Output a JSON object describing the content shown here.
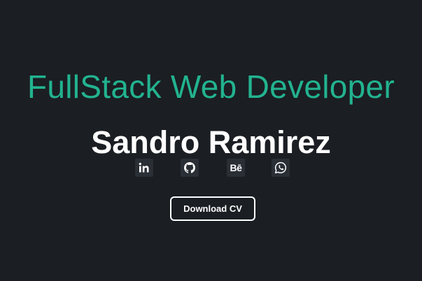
{
  "hero": {
    "role": "FullStack Web Developer",
    "name": "Sandro Ramirez",
    "download_label": "Download CV"
  },
  "socials": [
    {
      "name": "linkedin",
      "icon": "linkedin-icon",
      "text": "in"
    },
    {
      "name": "github",
      "icon": "github-icon"
    },
    {
      "name": "behance",
      "icon": "behance-icon",
      "text": "Bē"
    },
    {
      "name": "whatsapp",
      "icon": "whatsapp-icon"
    }
  ],
  "colors": {
    "background": "#1b1e23",
    "accent": "#22b38f",
    "text": "#ffffff",
    "icon_bg": "#2a2e35"
  }
}
